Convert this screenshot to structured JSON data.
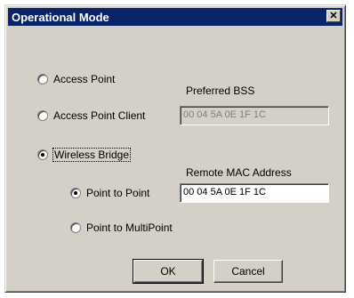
{
  "dialog": {
    "title": "Operational Mode",
    "close_glyph": "✕"
  },
  "modes": [
    {
      "label": "Access Point",
      "checked": false
    },
    {
      "label": "Access Point Client",
      "checked": false
    },
    {
      "label": "Wireless Bridge",
      "checked": true
    }
  ],
  "preferred_bss": {
    "label": "Preferred BSS",
    "value": "00 04 5A 0E 1F 1C",
    "enabled": false
  },
  "bridge": {
    "remote_mac_label": "Remote MAC Address",
    "remote_mac_value": "00 04 5A 0E 1F 1C",
    "options": [
      {
        "label": "Point to Point",
        "checked": true
      },
      {
        "label": "Point to MultiPoint",
        "checked": false
      }
    ]
  },
  "buttons": {
    "ok": "OK",
    "cancel": "Cancel"
  },
  "colors": {
    "titlebar": "#0a246a",
    "face": "#d4d0c8"
  },
  "icons": {
    "close": "close-icon"
  }
}
